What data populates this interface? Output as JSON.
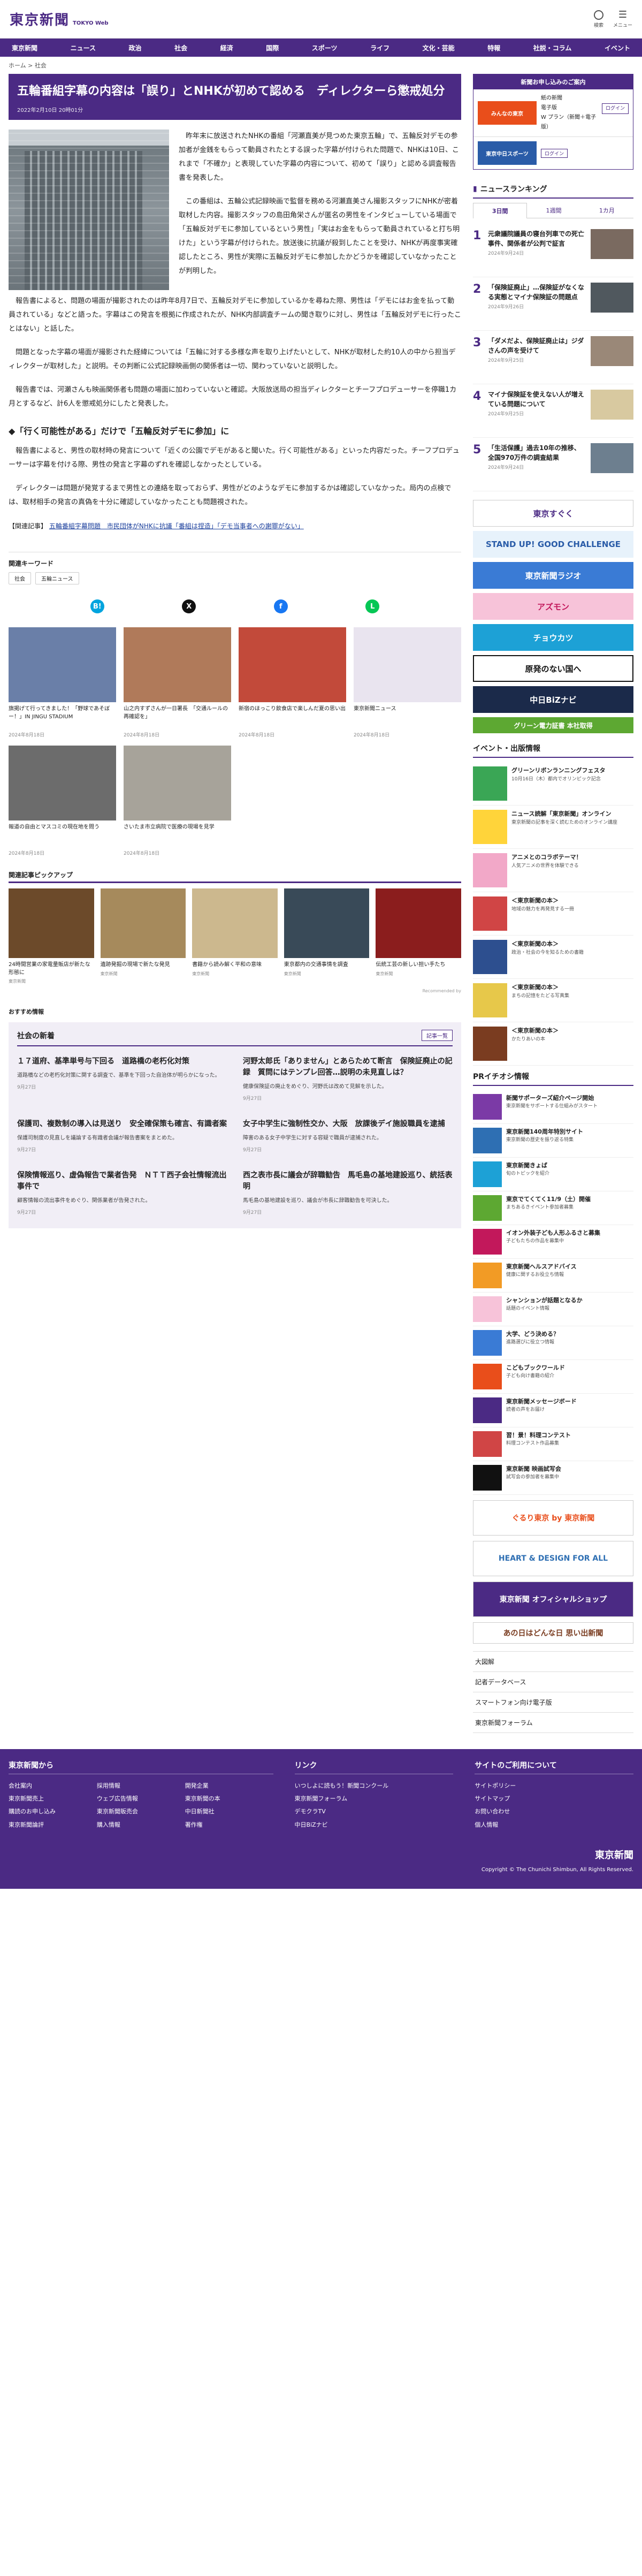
{
  "brand": {
    "name": "東京新聞",
    "sub": "TOKYO Web",
    "color": "#4b2a84"
  },
  "topbar": {
    "icons": [
      {
        "name": "search-icon",
        "label": "検索"
      },
      {
        "name": "menu-icon",
        "label": "メニュー"
      }
    ]
  },
  "nav": [
    "東京新聞",
    "ニュース",
    "政治",
    "社会",
    "経済",
    "国際",
    "スポーツ",
    "ライフ",
    "文化・芸能",
    "特報",
    "社説・コラム",
    "イベント"
  ],
  "breadcrumb": "ホーム > 社会",
  "article": {
    "title": "五輪番組字幕の内容は「誤り」とNHKが初めて認める　ディレクターら懲戒処分",
    "date": "2022年2月10日 20時01分",
    "paras": [
      "昨年末に放送されたNHKの番組「河瀬直美が見つめた東京五輪」で、五輪反対デモの参加者が金銭をもらって動員されたとする誤った字幕が付けられた問題で、NHKは10日、これまで「不確か」と表現していた字幕の内容について、初めて「誤り」と認める調査報告書を発表した。",
      "この番組は、五輪公式記録映画で監督を務める河瀬直美さん撮影スタッフにNHKが密着取材した内容。撮影スタッフの島田角栄さんが匿名の男性をインタビューしている場面で「五輪反対デモに参加しているという男性」「実はお金をもらって動員されていると打ち明けた」という字幕が付けられた。放送後に抗議が殺到したことを受け、NHKが再度事実確認したところ、男性が実際に五輪反対デモに参加したかどうかを確認していなかったことが判明した。",
      "報告書によると、問題の場面が撮影されたのは昨年8月7日で、五輪反対デモに参加しているかを尋ねた際、男性は「デモにはお金を払って動員されている」などと語った。字幕はこの発言を根拠に作成されたが、NHK内部調査チームの聞き取りに対し、男性は「五輪反対デモに行ったことはない」と話した。",
      "問題となった字幕の場面が撮影された経緯については「五輪に対する多様な声を取り上げたいとして、NHKが取材した約10人の中から担当ディレクターが取材した」と説明。その判断に公式記録映画側の関係者は一切、関わっていないと説明した。",
      "報告書では、河瀬さんも映画関係者も問題の場面に加わっていないと確認。大阪放送局の担当ディレクターとチーフプロデューサーを停職1カ月とするなど、計6人を懲戒処分にしたと発表した。"
    ],
    "section_heading_1": "◆「行く可能性がある」だけで「五輪反対デモに参加」に",
    "paras2": [
      "報告書によると、男性の取材時の発言について「近くの公園でデモがあると聞いた。行く可能性がある」といった内容だった。チーフプロデューサーは字幕を付ける際、男性の発言と字幕のずれを確認しなかったとしている。",
      "ディレクターは問題が発覚するまで男性との連絡を取っておらず、男性がどのようなデモに参加するかは確認していなかった。局内の点検では、取材相手の発言の真偽を十分に確認していなかったことも問題視された。"
    ],
    "related_label": "【関連記事】",
    "related_links": [
      "五輪番組字幕問題　市民団体がNHKに抗議「番組は捏造」「デモ当事者への謝罪がない」"
    ]
  },
  "keywords": {
    "title": "関連キーワード",
    "items": [
      "社会",
      "五輪ニュース"
    ]
  },
  "share": [
    {
      "name": "hatena-icon",
      "glyph": "B!",
      "color": "#00a4de"
    },
    {
      "name": "x-icon",
      "glyph": "X",
      "color": "#111"
    },
    {
      "name": "facebook-icon",
      "glyph": "f",
      "color": "#1877f2"
    },
    {
      "name": "line-icon",
      "glyph": "L",
      "color": "#06c755"
    }
  ],
  "related_grid": [
    {
      "title": "旗掲げて行ってきました！「野球であそぼー！」IN JINGU STADIUM",
      "date": "2024年8月18日",
      "color": "#6a7fa8"
    },
    {
      "title": "山之内すずさんが一日署長　「交通ルールの再確認を」",
      "date": "2024年8月18日",
      "color": "#b07a5a"
    },
    {
      "title": "新宿のほっこり飲食店で楽しんだ夏の思い出",
      "date": "2024年8月18日",
      "color": "#c24a3a"
    },
    {
      "title": "東京新聞ニュース",
      "date": "2024年8月18日",
      "color": "#e9e4ef"
    },
    {
      "title": "報道の自由とマスコミの現在地を問う",
      "date": "2024年8月18日",
      "color": "#6c6c6c"
    },
    {
      "title": "さいたま市立病院で医療の現場を見学",
      "date": "2024年8月18日",
      "color": "#a7a39a"
    }
  ],
  "pickup": {
    "title": "関連記事ピックアップ",
    "items": [
      {
        "title": "24時間営業の家電量販店が新たな形態に",
        "source": "東京新聞",
        "color": "#6c4a2a"
      },
      {
        "title": "遺跡発掘の現場で新たな発見",
        "source": "東京新聞",
        "color": "#a68a5c"
      },
      {
        "title": "書籍から読み解く平和の意味",
        "source": "東京新聞",
        "color": "#ccb88e"
      },
      {
        "title": "東京都内の交通事情を調査",
        "source": "東京新聞",
        "color": "#394a58"
      },
      {
        "title": "伝統工芸の新しい担い手たち",
        "source": "東京新聞",
        "color": "#8b1d1d"
      }
    ],
    "powered": "Recommended by"
  },
  "osusume": "おすすめ情報",
  "society_news": {
    "title": "社会の新着",
    "more": "記事一覧",
    "items": [
      {
        "title": "１７道府、基準単号与下回る　道路橋の老朽化対策",
        "body": "道路橋などの老朽化対策に関する調査で、基準を下回った自治体が明らかになった。",
        "date": "9月27日"
      },
      {
        "title": "河野太郎氏「ありません」とあらためて断言　保険証廃止の記録　質問にはテンプレ回答…説明の未見直しは？",
        "body": "健康保険証の廃止をめぐり、河野氏は改めて見解を示した。",
        "date": "9月27日"
      },
      {
        "title": "保護司、複数制の導入は見送り　安全確保策も確言、有識者案",
        "body": "保護司制度の見直しを議論する有識者会議が報告書案をまとめた。",
        "date": "9月27日"
      },
      {
        "title": "女子中学生に強制性交か、大阪　放課後デイ施設職員を逮捕",
        "body": "障害のある女子中学生に対する容疑で職員が逮捕された。",
        "date": "9月27日"
      },
      {
        "title": "保険情報巡り、虚偽報告で業者告発　ＮＴＴ西子会社情報流出事件で",
        "body": "顧客情報の流出事件をめぐり、関係業者が告発された。",
        "date": "9月27日"
      },
      {
        "title": "西之表市長に議会が辞職勧告　馬毛島の基地建設巡り、統括表明",
        "body": "馬毛島の基地建設を巡り、議会が市長に辞職勧告を可決した。",
        "date": "9月27日"
      }
    ]
  },
  "side": {
    "subscribe_head": "新聞お申し込みのご案内",
    "subscribe_lines": [
      "紙の新聞",
      "電子版",
      "W プラン（新聞＋電子版）"
    ],
    "login": "ログイン",
    "tokyo_chunichi": "東京中日スポーツ",
    "ranking_title": "ニュースランキング",
    "ranking_tabs": [
      "3日間",
      "1週間",
      "1カ月"
    ],
    "ranking": [
      {
        "n": "1",
        "title": "元衆議院議員の寝台列車での死亡事件、関係者が公判で証言",
        "date": "2024年9月24日"
      },
      {
        "n": "2",
        "title": "「保険証廃止」…保険証がなくなる実態とマイナ保険証の問題点",
        "date": "2024年9月26日"
      },
      {
        "n": "3",
        "title": "「ダメだよ、保険証廃止は」ジダさんの声を受けて",
        "date": "2024年9月25日"
      },
      {
        "n": "4",
        "title": "マイナ保険証を使えない人が増えている問題について",
        "date": "2024年9月25日"
      },
      {
        "n": "5",
        "title": "「生活保護」過去10年の推移、全国970万件の調査結果",
        "date": "2024年9月24日"
      }
    ],
    "banners": [
      {
        "text": "東京すぐく",
        "bg": "#ffffff",
        "fg": "#4b2a84"
      },
      {
        "text": "STAND UP! GOOD CHALLENGE",
        "bg": "#e7f2fb",
        "fg": "#2a5ca8"
      },
      {
        "text": "東京新聞ラジオ",
        "bg": "#3a7bd5",
        "fg": "#ffffff"
      },
      {
        "text": "アズモン",
        "bg": "#f7c3d9",
        "fg": "#c2185b"
      },
      {
        "text": "チョウカツ",
        "bg": "#1da1d6",
        "fg": "#ffffff"
      },
      {
        "text": "原発のない国へ",
        "bg": "#ffffff",
        "fg": "#111111"
      },
      {
        "text": "中日BiZナビ",
        "bg": "#1b2a4a",
        "fg": "#ffffff"
      },
      {
        "text": "グリーン電力証書 本社取得",
        "bg": "#5da832",
        "fg": "#ffffff"
      }
    ],
    "event_title": "イベント・出版情報",
    "events": [
      {
        "title": "グリーンリボンランニングフェスタ",
        "body": "10月16日（木）都内でオリンピック記念",
        "color": "#3aa655"
      },
      {
        "title": "ニュース読解「東京新聞」オンライン",
        "body": "東京新聞の記事を深く読むためのオンライン講座",
        "color": "#ffd43a"
      },
      {
        "title": "アニメとのコラボテーマ！",
        "body": "人気アニメの世界を体験できる",
        "color": "#f2a8c8"
      },
      {
        "title": "＜東京新聞の本＞",
        "body": "地域の魅力を再発見する一冊",
        "color": "#d04545"
      },
      {
        "title": "＜東京新聞の本＞",
        "body": "政治・社会の今を知るための書籍",
        "color": "#2d4f8f"
      },
      {
        "title": "＜東京新聞の本＞",
        "body": "まちの記憶をたどる写真集",
        "color": "#e7c84a"
      },
      {
        "title": "＜東京新聞の本＞",
        "body": "かたりあいの本",
        "color": "#7a3c20"
      }
    ],
    "pr_title": "PRイチオシ情報",
    "prs": [
      {
        "title": "新聞サポーターズ紹介ページ開始",
        "body": "東京新聞をサポートする仕組みがスタート",
        "color": "#7b3aa6"
      },
      {
        "title": "東京新聞140周年特別サイト",
        "body": "東京新聞の歴史を振り返る特集",
        "color": "#2e6fb3"
      },
      {
        "title": "東京新聞きょば",
        "body": "旬のトピックを紹介",
        "color": "#1da1d6"
      },
      {
        "title": "東京でてくてく11/9（土）開催",
        "body": "まちあるきイベント参加者募集",
        "color": "#5da832"
      },
      {
        "title": "イオン外装子ども人形ふるさと募集",
        "body": "子どもたちの作品を募集中",
        "color": "#c2185b"
      },
      {
        "title": "東京新聞ヘルスアドバイス",
        "body": "健康に関するお役立ち情報",
        "color": "#f29b25"
      },
      {
        "title": "シャンションが話題となるか",
        "body": "話題のイベント情報",
        "color": "#f7c3d9"
      },
      {
        "title": "大学、どう決める？",
        "body": "進路選びに役立つ情報",
        "color": "#3a7bd5"
      },
      {
        "title": "こどもブックワールド",
        "body": "子ども向け書籍の紹介",
        "color": "#e94e1b"
      },
      {
        "title": "東京新聞メッセージボード",
        "body": "読者の声をお届け",
        "color": "#4b2a84"
      },
      {
        "title": "習！景！料理コンテスト",
        "body": "料理コンテスト作品募集",
        "color": "#d04545"
      },
      {
        "title": "東京新聞 映画試写会",
        "body": "試写会の参加者を募集中",
        "color": "#111111"
      }
    ],
    "bigbanners": [
      "ぐるり東京 by 東京新聞",
      "HEART & DESIGN FOR ALL",
      "東京新聞 オフィシャルショップ",
      "あの日はどんな日 思い出新聞"
    ],
    "tiles": [
      "大図解",
      "記者データベース",
      "スマートフォン向け電子版",
      "東京新聞フォーラム"
    ]
  },
  "footer": {
    "col1_title": "東京新聞から",
    "col1_links": [
      "会社案内",
      "採用情報",
      "開発企業",
      "東京新聞売上",
      "ウェブ広告情報",
      "東京新聞の本",
      "購読のお申し込み",
      "東京新聞販売会",
      "中日新聞社",
      "東京新聞論評",
      "購入情報",
      "著作権"
    ],
    "col2_title": "リンク",
    "col2_links": [
      "いつしよに読もう！新聞コンクール",
      "東京新聞フォーラム",
      "デモクラTV",
      "中日BiZナビ"
    ],
    "col3_title": "サイトのご利用について",
    "col3_links": [
      "サイトポリシー",
      "サイトマップ",
      "お問い合わせ",
      "個人情報"
    ],
    "copyright": "Copyright © The Chunichi Shimbun, All Rights Reserved."
  }
}
